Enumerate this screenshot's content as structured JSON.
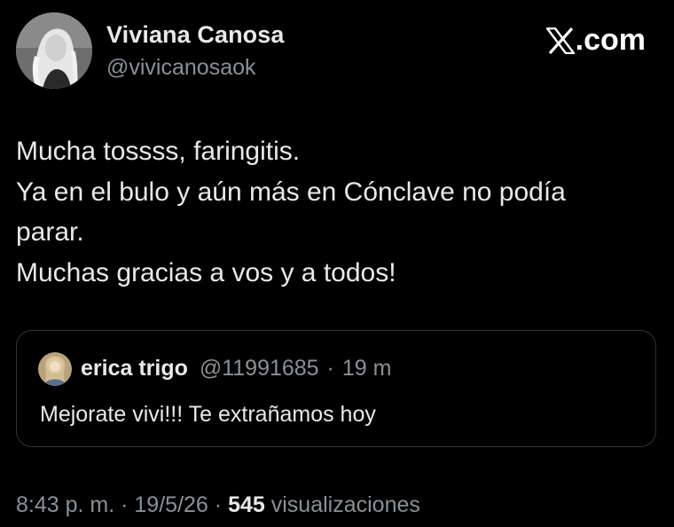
{
  "author": {
    "name": "Viviana Canosa",
    "handle": "@vivicanosaok",
    "avatar_icon": "profile-photo"
  },
  "brand": {
    "label": ".com",
    "logo_icon": "x-logo-icon"
  },
  "tweet": {
    "lines": [
      "Mucha tossss, faringitis.",
      "Ya en el bulo y aún más en Cónclave no podía",
      "parar.",
      "Muchas gracias a vos y a todos!"
    ]
  },
  "quote": {
    "name": "erica trigo",
    "handle": "@11991685",
    "separator": "·",
    "time": "19 m",
    "text": "Mejorate vivi!!!  Te extrañamos hoy",
    "avatar_icon": "quote-profile-photo"
  },
  "footer": {
    "time": "8:43 p. m.",
    "separator": "·",
    "date": "19/5/26",
    "views_count": "545",
    "views_label": "visualizaciones"
  },
  "colors": {
    "background": "#000000",
    "primary_text": "#e7e9ea",
    "secondary_text": "#8b9096",
    "border": "#2f3336"
  }
}
